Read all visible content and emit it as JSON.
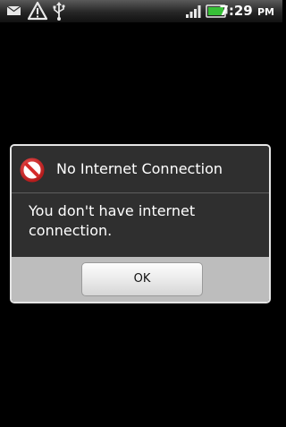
{
  "status_bar": {
    "time": "7:29",
    "time_suffix": "PM",
    "icons": [
      "message-icon",
      "warning-icon",
      "usb-icon",
      "signal-bars-icon",
      "battery-icon"
    ],
    "battery_color": "#38c038"
  },
  "dialog": {
    "icon": "no-entry-icon",
    "icon_color": "#d52b2b",
    "title": "No Internet Connection",
    "message": "You don't have internet connection.",
    "button_label": "OK"
  }
}
